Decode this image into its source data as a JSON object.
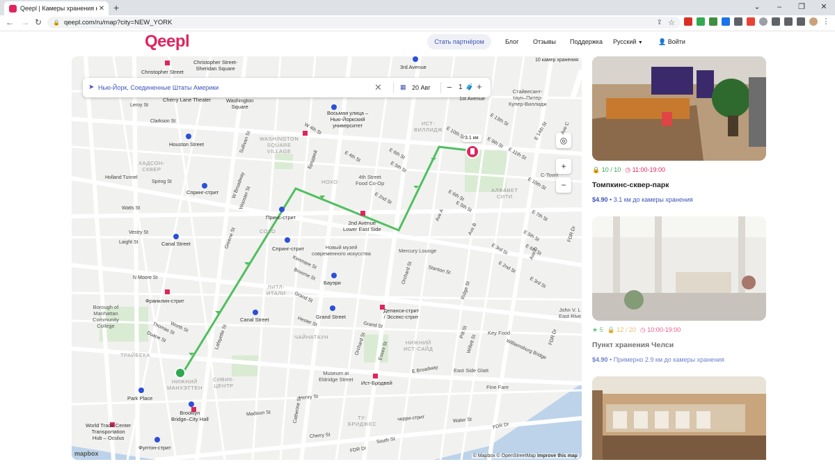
{
  "browser": {
    "tab_title": "Qeepl | Камеры хранения на карте",
    "tab_close": "✕",
    "new_tab": "+",
    "url": "qeepl.com/ru/map?city=NEW_YORK"
  },
  "header": {
    "logo": "Qeepl",
    "partner_label": "Стать партнёром",
    "blog": "Блог",
    "reviews": "Отзывы",
    "support": "Поддержка",
    "language": "Русский",
    "login": "Войти"
  },
  "search": {
    "address": "Нью-Йорк, Соединенные Штаты Америки",
    "date": "20 Авг",
    "bags_count": "1"
  },
  "map": {
    "scale_label": "10 камер хранения",
    "distance_label": "3.1 км",
    "attribution": "© Mapbox © OpenStreetMap",
    "improve": "Improve this map",
    "mapbox_logo": "mapbox",
    "zoom_in": "+",
    "zoom_out": "−",
    "labels": {
      "christopher": "Christopher Street",
      "christopher_sheridan": "Christopher Street-\nSheridan Square",
      "third_ave": "3rd Avenue",
      "cherry_lane": "Cherry Lane Theater",
      "washington_sq": "Washington\nSquare",
      "leroy": "Leroy St",
      "clarkson": "Clarkson St",
      "houston": "Houston Street",
      "hudson_sq": "ХАДСОН-\nСКВЕР",
      "holland": "Holland Tunnel",
      "spring_st": "Spring St",
      "spring_station": "Спринг-стрит",
      "watts": "Watts St",
      "vestry": "Vestry St",
      "laight": "Laight St",
      "canal_st": "Canal Street",
      "n_moore": "N Moore St",
      "franklin": "Франклин-стрит",
      "bmcc": "Borough of\nManhattan\nCommunity\nCollege",
      "thomas": "Thomas St",
      "duane": "Duane St",
      "worth": "Worth St",
      "tribeca": "ТРАЙБЕКА",
      "park_place": "Park Place",
      "wtc": "World Trade Center\nTransportation\nHub – Oculus",
      "brooklyn_bridge": "Brooklyn\nBridge–City Hall",
      "fulton": "Фултон-стрит",
      "wsv": "WASHINGTON\nSQUARE\nVILLAGE",
      "eighth_st": "Восьмая улица –\nНью-Йоркский\nуниверситет",
      "east_village": "ИСТ-\nВИЛЛИДЖ",
      "noho": "НОХО",
      "fourth_street": "4th Street\nFood Co-Op",
      "prince": "Принс-стрит",
      "soho": "СОХО",
      "spring2": "Спринг-стрит",
      "new_museum": "Новый музей\nсовременного искусства",
      "second_ave": "2nd Avenue\nLower East Side",
      "mercury": "Mercury Lounge",
      "bowery": "Бауэри",
      "little_italy": "ЛИТЛ-\nИТАЛИ",
      "grand_st": "Grand Street",
      "canal2": "Canal Street",
      "chinatown": "ЧАЙНАТАУН",
      "delancey": "Деланси-стрит\n/ Эссекс-стрит",
      "les": "НИЖНИЙ\nИСТ-САЙД",
      "key_food": "Key Food",
      "williamsburg": "Williamsburg Bridge",
      "eldridge": "Museum at\nEldridge Street",
      "east_broadway": "Ист-Бродвей",
      "e_broadway_st": "E Broadway",
      "east_side_glatt": "East Side Glatt",
      "fine_fare": "Fine Fare",
      "civic": "СИВИК-\nЦЕНТР",
      "lower_manhattan": "НИЖНИЙ\nМАНХЭТТЕН",
      "two_bridges": "ТУ-\nБРИДЖЕС",
      "cherry_st": "черри-стрит",
      "water_st": "Water St",
      "south_st": "South St",
      "fdr": "FDR Dr",
      "stuyvesant": "Стайвесант-\nтаун–Питер-\nКупер-Виллидж",
      "alphabet": "АЛФАВЕТ\nСИТИ",
      "first_ave": "1st Avenue",
      "c_town": "C-Town",
      "john_v": "John V. L\nEast Rive",
      "avenue_a": "Ave A",
      "avenue_b": "Ave B",
      "avenue_d": "Ave D",
      "broadway": "Бродвей",
      "w4th": "W 4th St",
      "sullivan": "Sullivan St",
      "w_broadway": "W Broadway",
      "wooster": "Wooster St",
      "greene": "Greene St",
      "lafayette": "Lafayette St",
      "kenmare": "Kenmare St",
      "broome": "Broome St",
      "grand": "Grand St",
      "hester": "Hester St",
      "orchard": "Orchard St",
      "ridge": "Ridge St",
      "stanton": "Stanton St",
      "pitt": "Pitt St",
      "willett": "Willett St",
      "essex": "Essex St",
      "henry": "Henry St",
      "madison": "Madison St",
      "catherine": "Catherine St",
      "cherry": "Cherry St",
      "e4th": "E 4th St",
      "e6th": "E 6th St",
      "e5th": "E 5th St",
      "e2nd": "E 2nd St",
      "e10th": "E 10th St",
      "e13th": "E 13th St",
      "e11th": "E 11th St",
      "e7th": "E 7th St",
      "e3rd": "E 3rd St",
      "e8th": "E 8th St",
      "e9th": "E 9th St",
      "e14th": "E 14th St",
      "e5th2": "E 5th St",
      "e6th2": "E 6th St",
      "e10th2": "E 10th St",
      "ave_c": "Ave C"
    }
  },
  "listings": [
    {
      "rating_badge": "10 / 10",
      "hours": "11:00-19:00",
      "title": "Томпкинс-сквер-парк",
      "price": "$4.90",
      "distance": "• 3.1 км до камеры хранения"
    },
    {
      "stars": "5",
      "rating_badge": "12 / 20",
      "hours": "10:00-19:00",
      "title": "Пункт хранения Челси",
      "price": "$4.90",
      "distance": "• Примерно 2.9 км до камеры хранения"
    }
  ],
  "colors": {
    "brand": "#e0245e",
    "accent": "#3d55b8",
    "route": "#4fbf5f",
    "open_green": "#2fa84f",
    "time_red": "#e0245e"
  }
}
